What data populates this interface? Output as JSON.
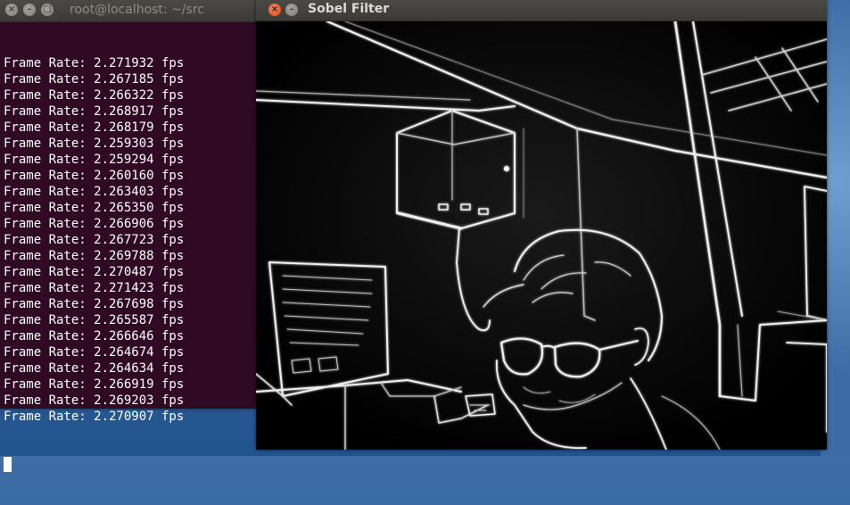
{
  "terminal": {
    "title": "root@localhost: ~/src",
    "lines": [
      "Frame Rate: 2.271932 fps",
      "Frame Rate: 2.267185 fps",
      "Frame Rate: 2.266322 fps",
      "Frame Rate: 2.268917 fps",
      "Frame Rate: 2.268179 fps",
      "Frame Rate: 2.259303 fps",
      "Frame Rate: 2.259294 fps",
      "Frame Rate: 2.260160 fps",
      "Frame Rate: 2.263403 fps",
      "Frame Rate: 2.265350 fps",
      "Frame Rate: 2.266906 fps",
      "Frame Rate: 2.267723 fps",
      "Frame Rate: 2.269788 fps",
      "Frame Rate: 2.270487 fps",
      "Frame Rate: 2.271423 fps",
      "Frame Rate: 2.267698 fps",
      "Frame Rate: 2.265587 fps",
      "Frame Rate: 2.266646 fps",
      "Frame Rate: 2.264674 fps",
      "Frame Rate: 2.264634 fps",
      "Frame Rate: 2.266919 fps",
      "Frame Rate: 2.269203 fps",
      "Frame Rate: 2.270907 fps"
    ]
  },
  "sobel": {
    "title": "Sobel Filter"
  },
  "colors": {
    "terminal_bg": "#300a24",
    "titlebar": "#3c3b37",
    "close_active": "#df4a16",
    "desktop": "#2f5f99"
  }
}
